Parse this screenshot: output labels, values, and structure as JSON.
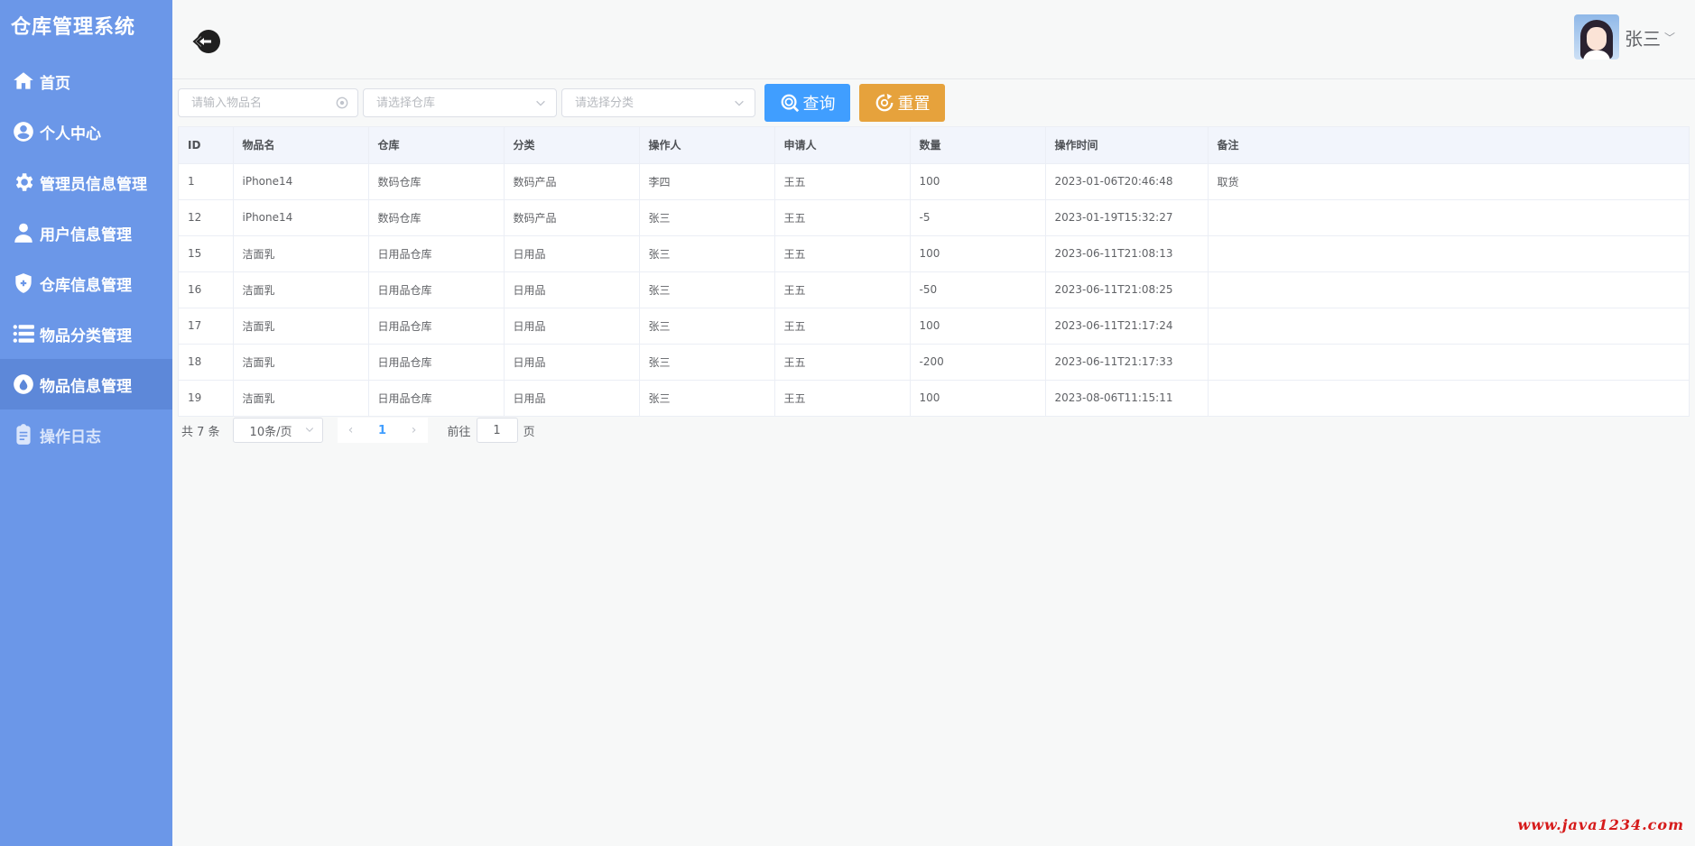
{
  "app": {
    "title": "仓库管理系统"
  },
  "sidebar": {
    "items": [
      {
        "label": "首页",
        "icon": "home-icon"
      },
      {
        "label": "个人中心",
        "icon": "user-circle-icon"
      },
      {
        "label": "管理员信息管理",
        "icon": "gear-icon"
      },
      {
        "label": "用户信息管理",
        "icon": "user-icon"
      },
      {
        "label": "仓库信息管理",
        "icon": "shield-icon"
      },
      {
        "label": "物品分类管理",
        "icon": "list-icon"
      },
      {
        "label": "物品信息管理",
        "icon": "drop-icon"
      },
      {
        "label": "操作日志",
        "icon": "clipboard-icon"
      }
    ]
  },
  "header": {
    "username": "张三",
    "back_icon": "back-arrow-icon"
  },
  "filters": {
    "item_placeholder": "请输入物品名",
    "warehouse_placeholder": "请选择仓库",
    "category_placeholder": "请选择分类",
    "query_label": "查询",
    "reset_label": "重置"
  },
  "table": {
    "columns": [
      "ID",
      "物品名",
      "仓库",
      "分类",
      "操作人",
      "申请人",
      "数量",
      "操作时间",
      "备注"
    ],
    "rows": [
      [
        "1",
        "iPhone14",
        "数码仓库",
        "数码产品",
        "李四",
        "王五",
        "100",
        "2023-01-06T20:46:48",
        "取货"
      ],
      [
        "12",
        "iPhone14",
        "数码仓库",
        "数码产品",
        "张三",
        "王五",
        "-5",
        "2023-01-19T15:32:27",
        ""
      ],
      [
        "15",
        "洁面乳",
        "日用品仓库",
        "日用品",
        "张三",
        "王五",
        "100",
        "2023-06-11T21:08:13",
        ""
      ],
      [
        "16",
        "洁面乳",
        "日用品仓库",
        "日用品",
        "张三",
        "王五",
        "-50",
        "2023-06-11T21:08:25",
        ""
      ],
      [
        "17",
        "洁面乳",
        "日用品仓库",
        "日用品",
        "张三",
        "王五",
        "100",
        "2023-06-11T21:17:24",
        ""
      ],
      [
        "18",
        "洁面乳",
        "日用品仓库",
        "日用品",
        "张三",
        "王五",
        "-200",
        "2023-06-11T21:17:33",
        ""
      ],
      [
        "19",
        "洁面乳",
        "日用品仓库",
        "日用品",
        "张三",
        "王五",
        "100",
        "2023-08-06T11:15:11",
        ""
      ]
    ]
  },
  "pagination": {
    "total_text": "共 7 条",
    "page_size": "10条/页",
    "current_page": "1",
    "goto_prefix": "前往",
    "goto_value": "1",
    "goto_suffix": "页"
  },
  "watermark": "www.java1234.com",
  "colors": {
    "sidebar": "#6b97e8",
    "query": "#409eff",
    "reset": "#e6a23c"
  }
}
